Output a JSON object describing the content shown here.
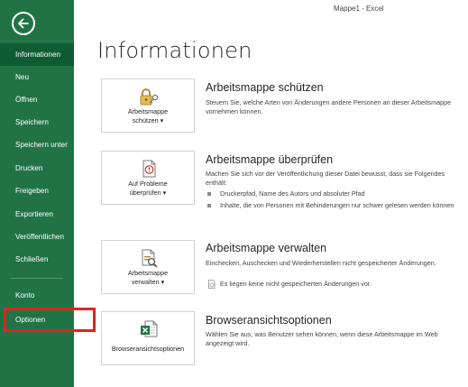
{
  "window": {
    "title": "Mappe1 - Excel"
  },
  "sidebar": {
    "items": [
      {
        "label": "Informationen",
        "selected": true
      },
      {
        "label": "Neu"
      },
      {
        "label": "Öffnen"
      },
      {
        "label": "Speichern"
      },
      {
        "label": "Speichern unter"
      },
      {
        "label": "Drucken"
      },
      {
        "label": "Freigeben"
      },
      {
        "label": "Exportieren"
      },
      {
        "label": "Veröffentlichen"
      },
      {
        "label": "Schließen"
      },
      {
        "label": "Konto"
      },
      {
        "label": "Optionen"
      }
    ]
  },
  "main": {
    "title": "Informationen",
    "sections": [
      {
        "button_line1": "Arbeitsmappe",
        "button_line2": "schützen ▾",
        "title": "Arbeitsmappe schützen",
        "description": "Steuern Sie, welche Arten von Änderungen andere Personen an dieser Arbeitsmappe vornehmen können.",
        "icon": "lock-key-icon"
      },
      {
        "button_line1": "Auf Probleme",
        "button_line2": "überprüfen ▾",
        "title": "Arbeitsmappe überprüfen",
        "description": "Machen Sie sich vor der Veröffentlichung dieser Datei bewusst, dass sie Folgendes enthält:",
        "bullets": [
          "Druckerpfad, Name des Autors und absoluter Pfad",
          "Inhalte, die von Personen mit Behinderungen nur schwer gelesen werden können"
        ],
        "icon": "inspect-document-icon"
      },
      {
        "button_line1": "Arbeitsmappe",
        "button_line2": "verwalten ▾",
        "title": "Arbeitsmappe verwalten",
        "description": "Einchecken, Auschecken und Wiederherstellen nicht gespeicherter Änderungen.",
        "note": "Es liegen keine nicht gespeicherten Änderungen vor.",
        "icon": "manage-workbook-icon"
      },
      {
        "button_line1": "Browseransichtsoptionen",
        "title": "Browseransichtsoptionen",
        "description": "Wählen Sie aus, was Benutzer sehen können, wenn diese Arbeitsmappe im Web angezeigt wird.",
        "icon": "excel-browser-icon"
      }
    ]
  },
  "colors": {
    "sidebar": "#217346",
    "sidebar_selected": "#0f5c34",
    "highlight": "#e2241a"
  }
}
